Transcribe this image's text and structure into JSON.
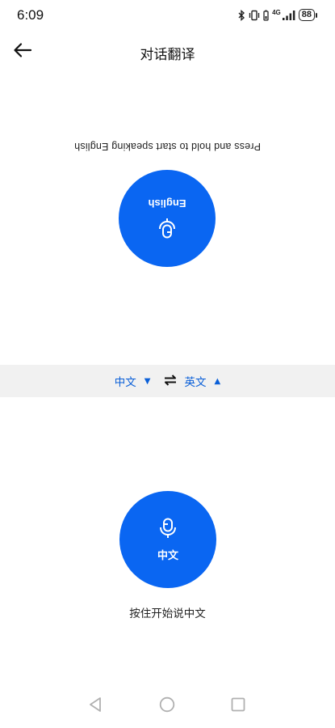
{
  "status_bar": {
    "time": "6:09",
    "network": "4G",
    "battery": "88",
    "icons": [
      "bluetooth-icon",
      "vibrate-icon",
      "battery-saver-icon",
      "signal-icon",
      "battery-icon"
    ]
  },
  "header": {
    "title": "对话翻译",
    "back_icon": "arrow-left-icon"
  },
  "partner": {
    "mic_label": "English",
    "hint": "Press and hold to start speaking English",
    "icon": "microphone-icon"
  },
  "language_bar": {
    "source_language": "中文",
    "target_language": "英文",
    "source_caret": "▼",
    "target_caret": "▲",
    "swap_icon": "swap-arrows-icon"
  },
  "self": {
    "mic_label": "中文",
    "hint": "按住开始说中文",
    "icon": "microphone-icon"
  },
  "colors": {
    "accent": "#0a66f2",
    "language_text": "#0a5fd8",
    "bar_background": "#f1f1f1"
  },
  "navigation": {
    "icons": [
      "back-triangle-icon",
      "home-circle-icon",
      "recents-square-icon"
    ]
  }
}
